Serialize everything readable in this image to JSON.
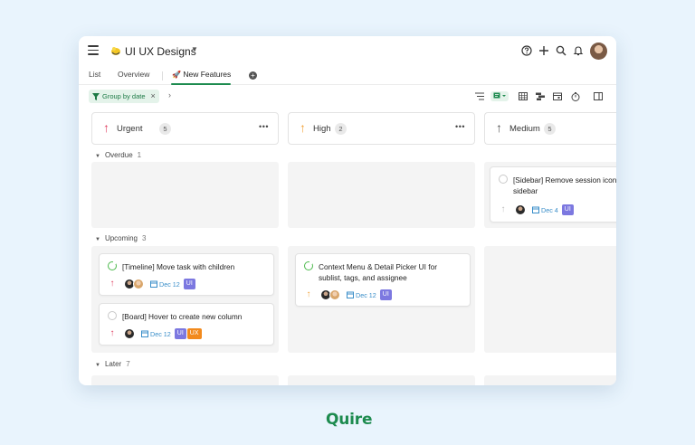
{
  "header": {
    "project_title": "UI UX Designs",
    "icons": [
      "menu-icon",
      "project-icon",
      "chevron-down-icon",
      "help-icon",
      "add-icon",
      "search-icon",
      "bell-icon",
      "avatar"
    ]
  },
  "tabs": [
    {
      "label": "List"
    },
    {
      "label": "Overview"
    },
    {
      "label": "New Features",
      "active": true
    }
  ],
  "toolbar": {
    "filter_chip": "Group by date",
    "icons": [
      "sort-icon",
      "board-view-icon",
      "table-view-icon",
      "timeline-icon",
      "calendar-icon",
      "timer-icon",
      "panel-icon"
    ]
  },
  "columns": [
    {
      "name": "Urgent",
      "count": "5",
      "arrow": "↑",
      "color": "#e04162"
    },
    {
      "name": "High",
      "count": "2",
      "arrow": "↑",
      "color": "#f2a33a"
    },
    {
      "name": "Medium",
      "count": "5",
      "arrow": "↑",
      "color": "#555555"
    }
  ],
  "groups": [
    {
      "label": "Overdue",
      "count": "1"
    },
    {
      "label": "Upcoming",
      "count": "3"
    },
    {
      "label": "Later",
      "count": "7"
    }
  ],
  "cards": {
    "medium_overdue": {
      "title_line1": "[Sidebar] Remove session icon",
      "title_line2": "sidebar",
      "date": "Dec 4",
      "tags": [
        "UI"
      ]
    },
    "urgent_up_1": {
      "title": "[Timeline] Move task with children",
      "date": "Dec 12",
      "tags": [
        "UI"
      ]
    },
    "urgent_up_2": {
      "title": "[Board] Hover to create new column",
      "date": "Dec 12",
      "tags": [
        "UI",
        "UX"
      ]
    },
    "high_up_1": {
      "title_line1": "Context Menu & Detail Picker UI for",
      "title_line2": "sublist, tags, and assignee",
      "date": "Dec 12",
      "tags": [
        "UI"
      ]
    }
  },
  "colors": {
    "accent": "#1d8b4f",
    "tag_ui": "#7c78e0",
    "tag_ux": "#f28a1d",
    "date": "#3a8ec9"
  },
  "brand": "Quire"
}
